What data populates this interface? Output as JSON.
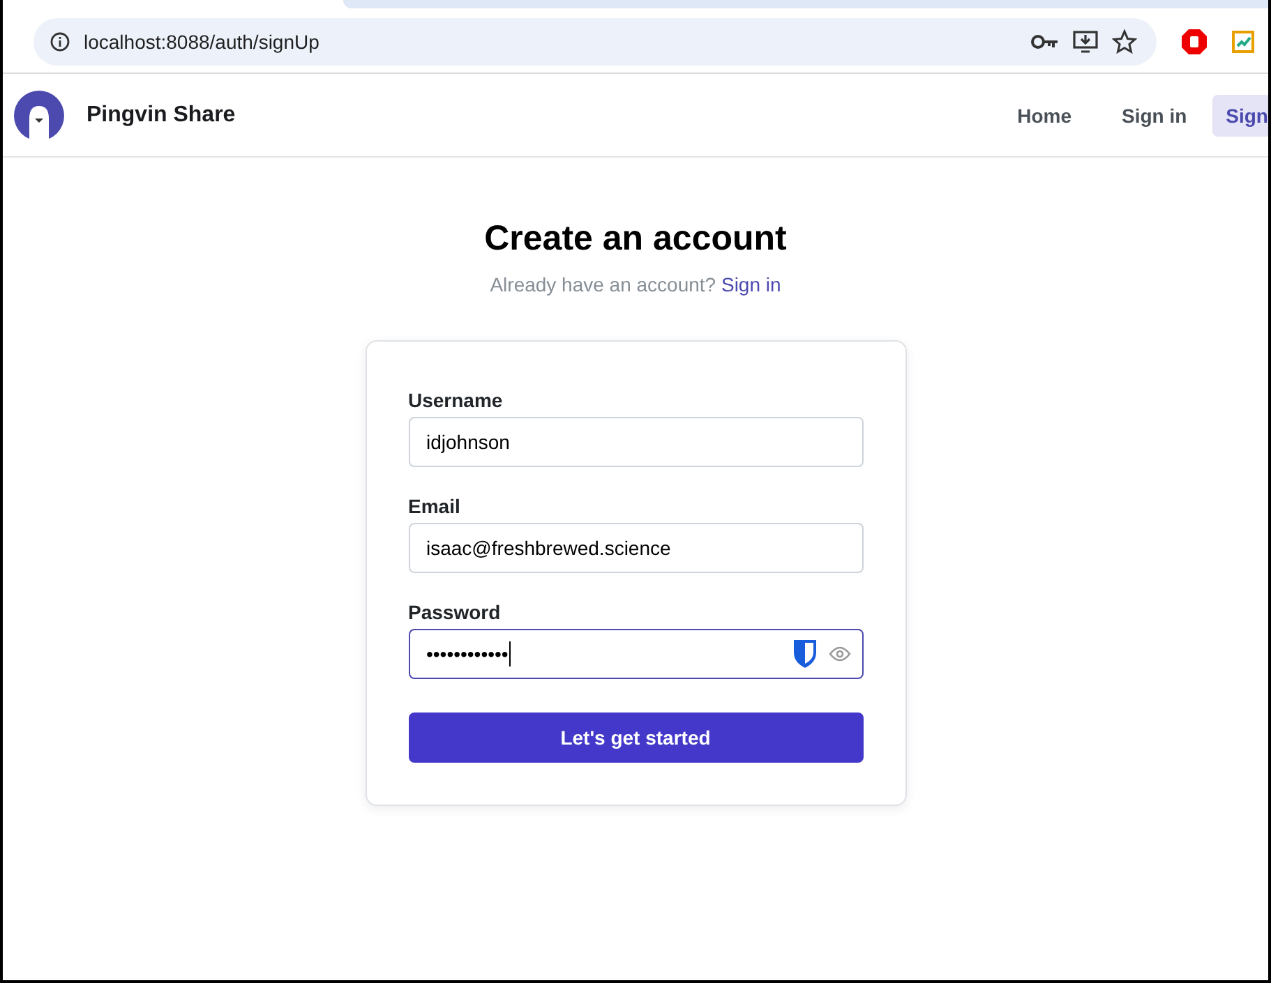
{
  "browser": {
    "url": "localhost:8088/auth/signUp"
  },
  "header": {
    "brand": "Pingvin Share",
    "nav": [
      {
        "label": "Home",
        "selected": false
      },
      {
        "label": "Sign in",
        "selected": false
      },
      {
        "label": "Sign",
        "selected": true
      }
    ]
  },
  "title": "Create an account",
  "subtitle": {
    "text": "Already have an account?",
    "link": "Sign in"
  },
  "fields": [
    {
      "label": "Username",
      "value": "idjohnson",
      "focused": false,
      "kind": "text"
    },
    {
      "label": "Email",
      "value": "isaac@freshbrewed.science",
      "focused": false,
      "kind": "text"
    },
    {
      "label": "Password",
      "value": "••••••••••••",
      "focused": true,
      "kind": "password"
    }
  ],
  "submit": "Let's get started"
}
